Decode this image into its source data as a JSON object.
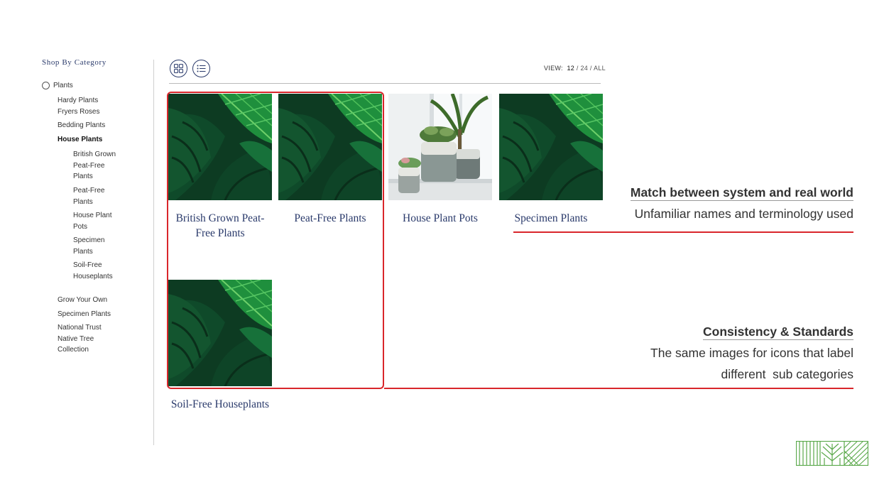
{
  "sidebar": {
    "title": "Shop By Category",
    "root": "Plants",
    "items": [
      {
        "label": "Hardy Plants"
      },
      {
        "label": "Fryers Roses"
      },
      {
        "label": "Bedding Plants"
      },
      {
        "label": "House Plants"
      },
      {
        "label": "British Grown Peat-Free Plants"
      },
      {
        "label": "Peat-Free Plants"
      },
      {
        "label": "House Plant Pots"
      },
      {
        "label": "Specimen Plants"
      },
      {
        "label": "Soil-Free Houseplants"
      },
      {
        "label": "Grow Your Own"
      },
      {
        "label": "Specimen Plants"
      },
      {
        "label": "National Trust Native Tree Collection"
      }
    ]
  },
  "toolbar": {
    "grid_icon": "grid-view-icon",
    "list_icon": "list-view-icon",
    "view_prefix": "VIEW:",
    "view_options": [
      "12",
      "24",
      "ALL"
    ],
    "view_selected": "12"
  },
  "products": [
    {
      "title": "British Grown Peat-Free Plants",
      "image": "monstera-leaves"
    },
    {
      "title": "Peat-Free Plants",
      "image": "monstera-leaves"
    },
    {
      "title": "House Plant Pots",
      "image": "potted-plants-on-windowsill"
    },
    {
      "title": "Specimen Plants",
      "image": "monstera-leaves"
    },
    {
      "title": "Soil-Free Houseplants",
      "image": "monstera-leaves"
    }
  ],
  "annotations": [
    {
      "heading": "Match between system and real world",
      "text": [
        "Unfamiliar names and terminology used"
      ]
    },
    {
      "heading": "Consistency & Standards",
      "text": [
        "The same images for icons that label",
        "different  sub categories"
      ]
    }
  ],
  "colors": {
    "accent": "#d9262b",
    "brand_navy": "#2a3a6b",
    "logo_green": "#5aa84a"
  }
}
